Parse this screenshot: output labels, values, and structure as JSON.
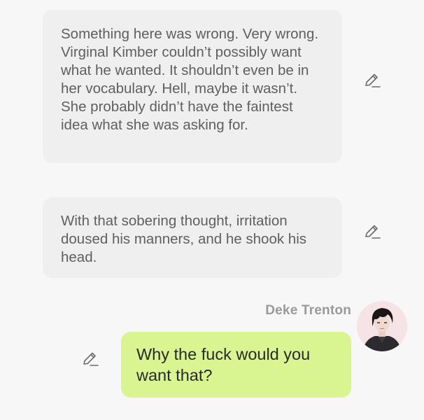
{
  "messages": [
    {
      "type": "narration",
      "text": "Something here was wrong. Very wrong. Virginal Kimber couldn’t possibly want what he wanted. It shouldn’t even be in her vocabulary. Hell, maybe it wasn’t. She probably didn’t have the faintest idea what she was asking for.",
      "edit_icon": "pencil-icon"
    },
    {
      "type": "narration",
      "text": "With that sobering thought, irritation doused his manners, and he shook his head.",
      "edit_icon": "pencil-icon"
    },
    {
      "type": "character",
      "speaker": "Deke Trenton",
      "avatar": "character-avatar",
      "text": "Why the fuck would you want that?",
      "edit_icon": "pencil-icon"
    }
  ],
  "colors": {
    "background": "#f7f7f7",
    "narration_bubble": "#efefef",
    "user_bubble": "#d8f592",
    "narration_text": "#5f5f5f",
    "speaker_name": "#9a9a9a"
  }
}
